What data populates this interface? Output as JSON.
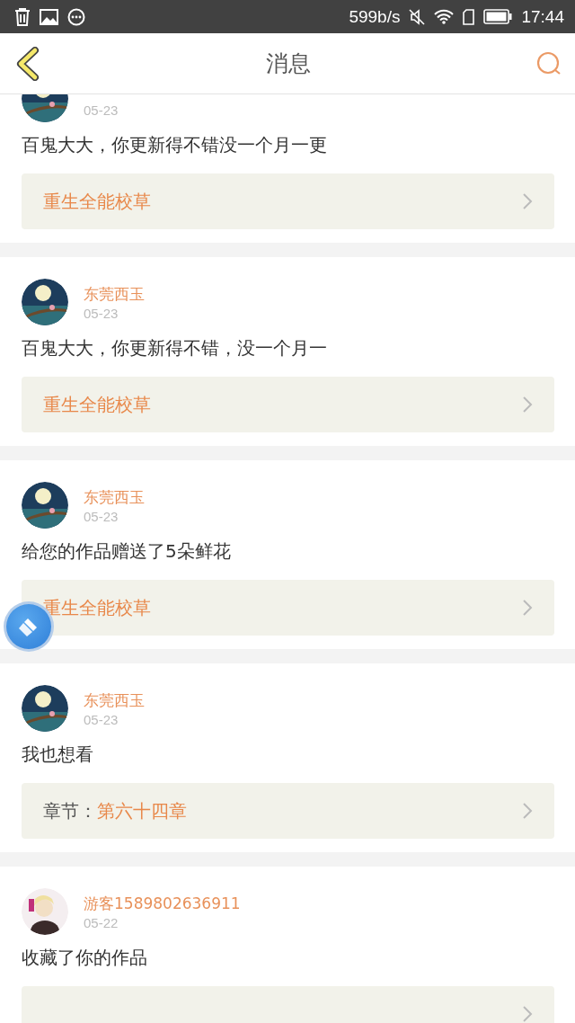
{
  "status_bar": {
    "speed": "599b/s",
    "time": "17:44"
  },
  "header": {
    "title": "消息"
  },
  "messages": [
    {
      "date": "05-23",
      "text": "百鬼大大，你更新得不错没一个月一更",
      "link": {
        "kind": "work",
        "title": "重生全能校草"
      }
    },
    {
      "name": "东莞西玉",
      "date": "05-23",
      "text": "百鬼大大，你更新得不错，没一个月一",
      "link": {
        "kind": "work",
        "title": "重生全能校草"
      }
    },
    {
      "name": "东莞西玉",
      "date": "05-23",
      "text": "给您的作品赠送了5朵鲜花",
      "link": {
        "kind": "work",
        "title": "重生全能校草"
      }
    },
    {
      "name": "东莞西玉",
      "date": "05-23",
      "text": "我也想看",
      "link": {
        "kind": "chapter",
        "prefix": "章节：",
        "title": "第六十四章"
      }
    },
    {
      "name": "游客1589802636911",
      "date": "05-22",
      "text": "收藏了你的作品",
      "link": {
        "kind": "work"
      }
    }
  ]
}
